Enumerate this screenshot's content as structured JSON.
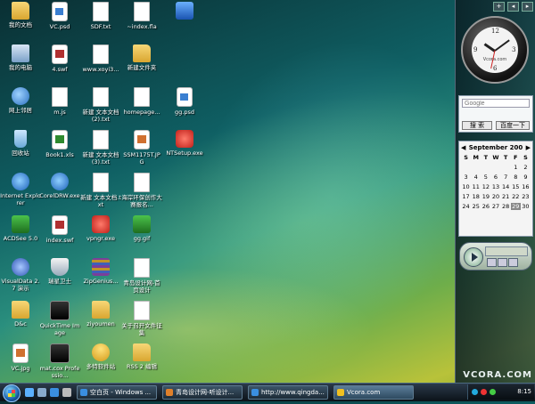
{
  "desktop": {
    "icons": [
      {
        "label": "我的文档",
        "glyph": "folder"
      },
      {
        "label": "VC.psd",
        "glyph": "psd"
      },
      {
        "label": "SDF.txt",
        "glyph": "doc"
      },
      {
        "label": "~index.fla",
        "glyph": "doc"
      },
      {
        "label": "",
        "glyph": "blue"
      },
      {
        "label": "我的电脑",
        "glyph": "comp"
      },
      {
        "label": "4.swf",
        "glyph": "swf"
      },
      {
        "label": "www.xoyi3...",
        "glyph": "doc"
      },
      {
        "label": "新建文件夹",
        "glyph": "folder"
      },
      {
        "label": "网上邻居",
        "glyph": "net"
      },
      {
        "label": "m.js",
        "glyph": "doc"
      },
      {
        "label": "新建 文本文档 (2).txt",
        "glyph": "doc"
      },
      {
        "label": "homepage...",
        "glyph": "doc"
      },
      {
        "label": "gg.psd",
        "glyph": "psd"
      },
      {
        "label": "回收站",
        "glyph": "bin"
      },
      {
        "label": "Book1.xls",
        "glyph": "xls"
      },
      {
        "label": "新建 文本文档 (3).txt",
        "glyph": "doc"
      },
      {
        "label": "SSM1175T.JPG",
        "glyph": "jpg"
      },
      {
        "label": "NTSetup.exe",
        "glyph": "red"
      },
      {
        "label": "Internet Explorer",
        "glyph": "ie"
      },
      {
        "label": "CorelDRW.exe",
        "glyph": "ie"
      },
      {
        "label": "新建 文本文档.txt",
        "glyph": "doc"
      },
      {
        "label": "海岸环保创作大赛报名...",
        "glyph": "doc"
      },
      {
        "label": "ACDSee 5.0",
        "glyph": "acd"
      },
      {
        "label": "index.swf",
        "glyph": "swf"
      },
      {
        "label": "vpngr.exe",
        "glyph": "red"
      },
      {
        "label": "gg.gif",
        "glyph": "acd"
      },
      {
        "label": "VisualData 2.7 演示",
        "glyph": "vb"
      },
      {
        "label": "瑞星卫士",
        "glyph": "shield"
      },
      {
        "label": "ZipGenius...",
        "glyph": "rar"
      },
      {
        "label": "青岛设计网-首页设计",
        "glyph": "doc"
      },
      {
        "label": "D&c",
        "glyph": "folder"
      },
      {
        "label": "QuickTime Image",
        "glyph": "vid"
      },
      {
        "label": "ziyoumen",
        "glyph": "folder"
      },
      {
        "label": "关于召开文件征集",
        "glyph": "doc"
      },
      {
        "label": "VC.jpg",
        "glyph": "jpg"
      },
      {
        "label": "mat.cox Professio...",
        "glyph": "vid"
      },
      {
        "label": "多特软件站",
        "glyph": "user"
      },
      {
        "label": "RSS 2 编辑",
        "glyph": "folder"
      }
    ]
  },
  "sidebar": {
    "controls": [
      "+",
      "◂",
      "▸"
    ],
    "clock": {
      "brand": "Vcora.com",
      "hour": 10,
      "minute": 9,
      "second": 32
    },
    "google": {
      "placeholder": "Google",
      "search_label": "搜 索",
      "baidu_label": "百度一下"
    },
    "calendar": {
      "month": "September 200",
      "prev": "◀",
      "next": "▶",
      "day_names": [
        "S",
        "M",
        "T",
        "W",
        "T",
        "F",
        "S"
      ],
      "days": [
        "",
        "",
        "",
        "",
        "",
        "1",
        "2",
        "3",
        "4",
        "5",
        "6",
        "7",
        "8",
        "9",
        "10",
        "11",
        "12",
        "13",
        "14",
        "15",
        "16",
        "17",
        "18",
        "19",
        "20",
        "21",
        "22",
        "23",
        "24",
        "25",
        "26",
        "27",
        "28",
        "29",
        "30"
      ],
      "today": "29"
    },
    "brand": "VCORA.COM"
  },
  "taskbar": {
    "tasks": [
      {
        "label": "空白页 - Windows ...",
        "color": "#3a8fe0"
      },
      {
        "label": "青岛设计网-听设计...",
        "color": "#e0802a"
      },
      {
        "label": "http://www.qingda...",
        "color": "#3a8fe0"
      },
      {
        "label": "Vcora.com",
        "color": "#f0c020"
      }
    ],
    "clock": "8:15"
  }
}
